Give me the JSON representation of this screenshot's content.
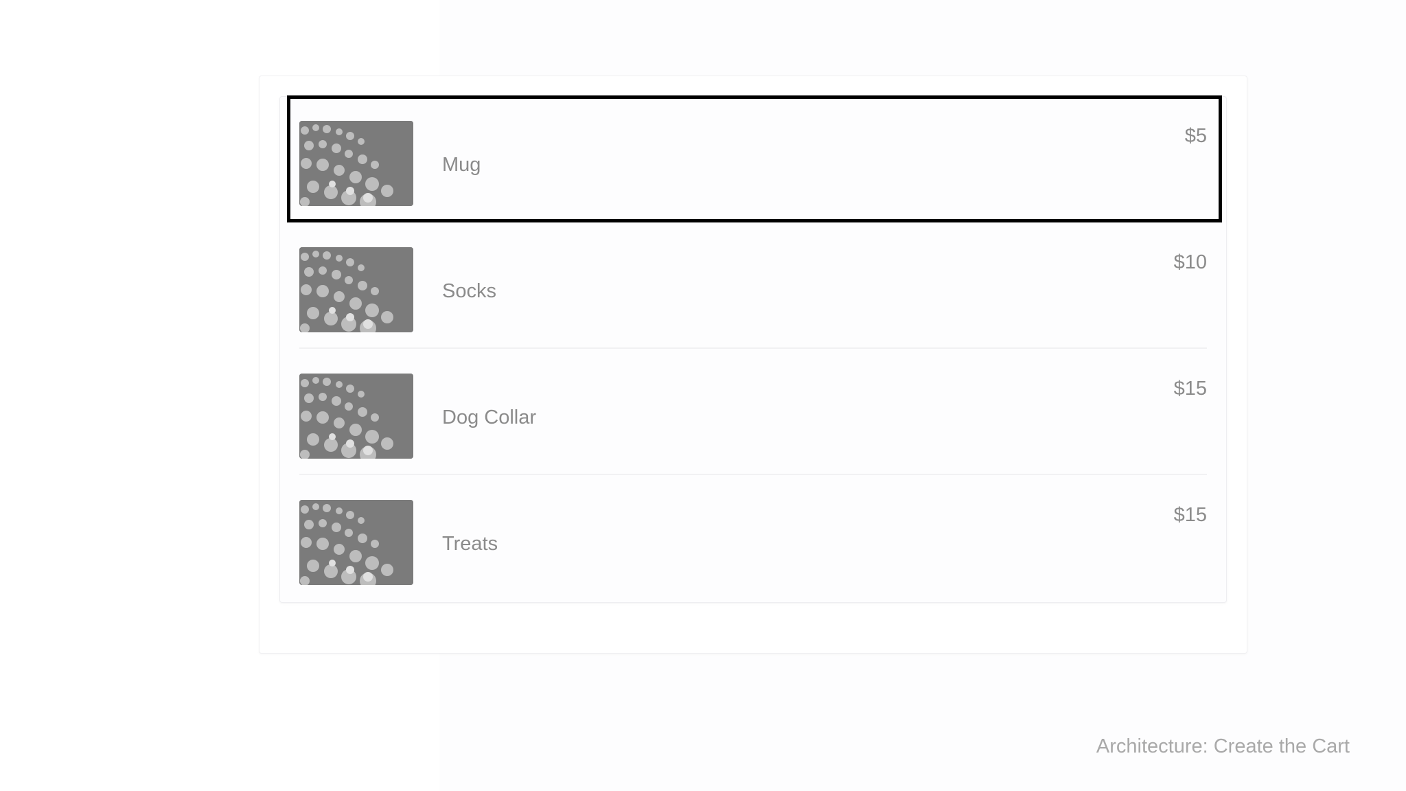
{
  "cart": {
    "items": [
      {
        "name": "Mug",
        "price": "$5"
      },
      {
        "name": "Socks",
        "price": "$10"
      },
      {
        "name": "Dog Collar",
        "price": "$15"
      },
      {
        "name": "Treats",
        "price": "$15"
      }
    ]
  },
  "footer": {
    "title": "Architecture: Create the Cart"
  },
  "colors": {
    "highlight_border": "#000000",
    "text": "#8b8b8b",
    "footer_text": "#a9a9a9"
  },
  "icons": {
    "thumbnail": "product-image-placeholder"
  }
}
